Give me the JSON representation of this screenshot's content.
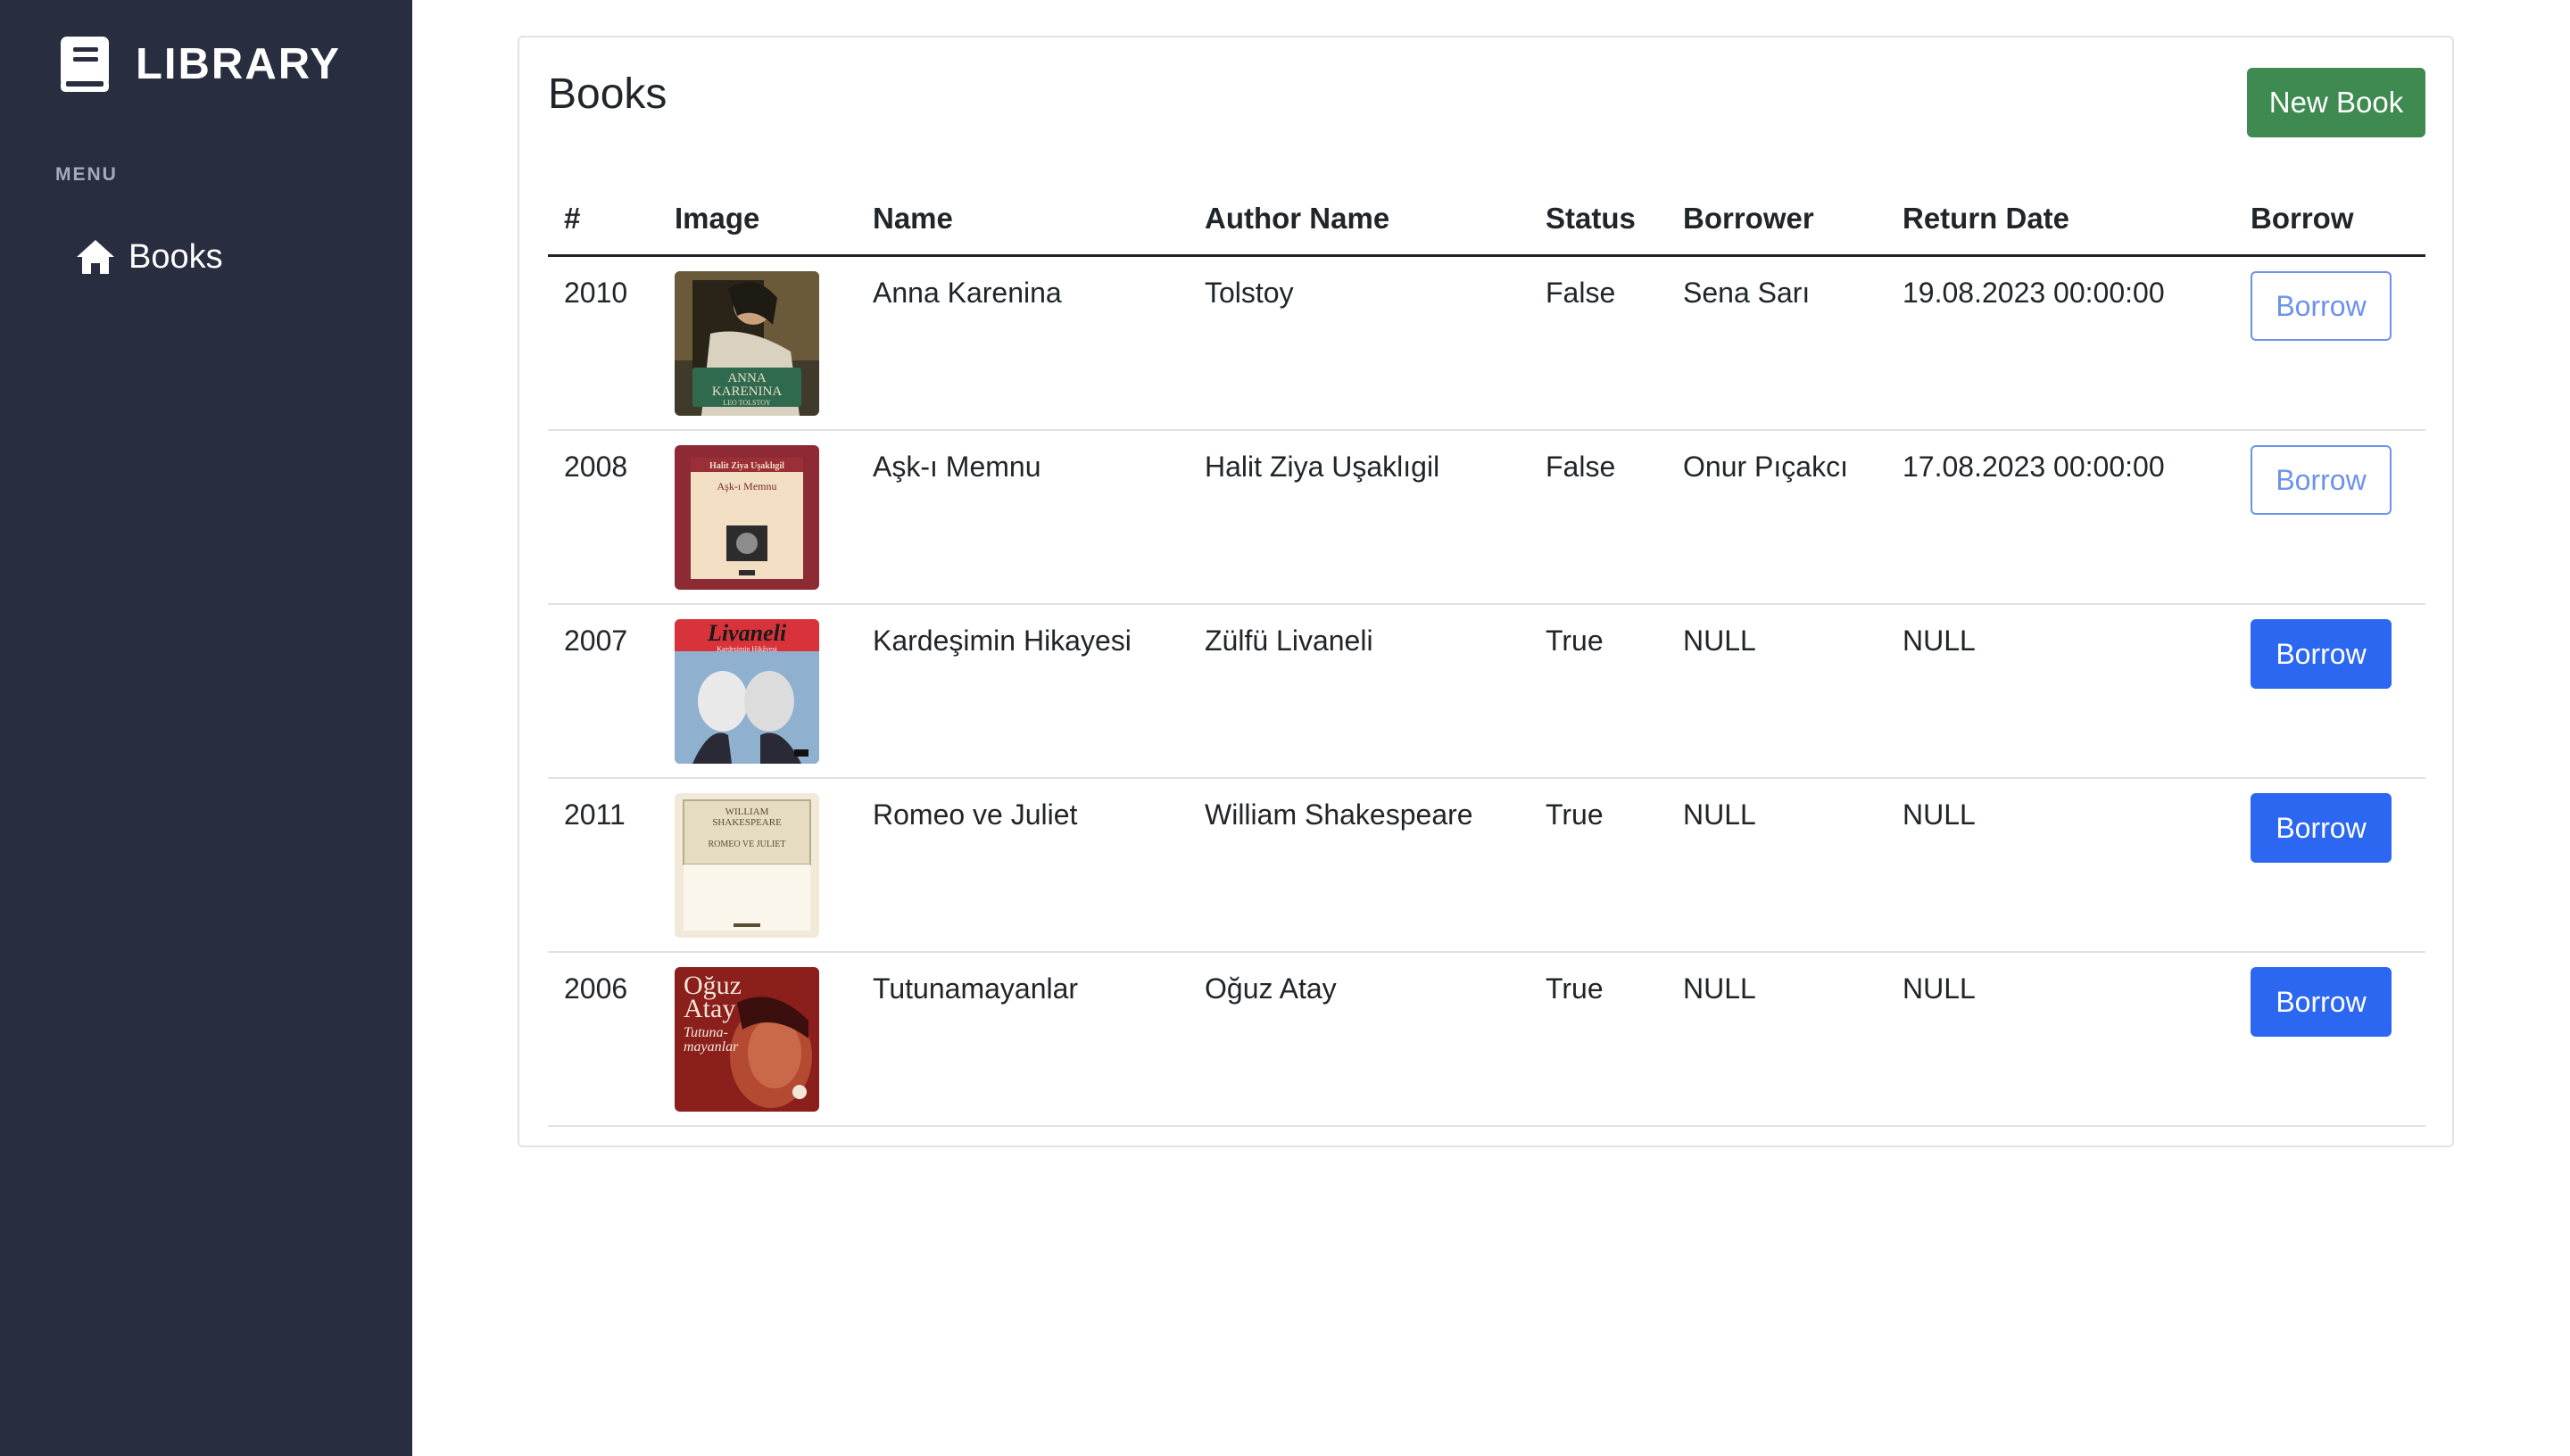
{
  "sidebar": {
    "brand": "LIBRARY",
    "menu_heading": "MENU",
    "items": [
      {
        "label": "Books",
        "icon": "home-icon"
      }
    ],
    "background": "#282d40"
  },
  "main": {
    "title": "Books",
    "new_book_label": "New Book",
    "table": {
      "headers": [
        "#",
        "Image",
        "Name",
        "Author Name",
        "Status",
        "Borrower",
        "Return Date",
        "Borrow"
      ],
      "rows": [
        {
          "id": "2010",
          "cover": "anna-karenina-cover",
          "name": "Anna Karenina",
          "author": "Tolstoy",
          "status": "False",
          "borrower": "Sena Sarı",
          "return_date": "19.08.2023 00:00:00",
          "borrow_label": "Borrow",
          "available": false
        },
        {
          "id": "2008",
          "cover": "ask-i-memnu-cover",
          "name": "Aşk-ı Memnu",
          "author": "Halit Ziya Uşaklıgil",
          "status": "False",
          "borrower": "Onur Pıçakcı",
          "return_date": "17.08.2023 00:00:00",
          "borrow_label": "Borrow",
          "available": false
        },
        {
          "id": "2007",
          "cover": "kardesimin-hikayesi-cover",
          "name": "Kardeşimin Hikayesi",
          "author": "Zülfü Livaneli",
          "status": "True",
          "borrower": "NULL",
          "return_date": "NULL",
          "borrow_label": "Borrow",
          "available": true
        },
        {
          "id": "2011",
          "cover": "romeo-ve-juliet-cover",
          "name": "Romeo ve Juliet",
          "author": "William Shakespeare",
          "status": "True",
          "borrower": "NULL",
          "return_date": "NULL",
          "borrow_label": "Borrow",
          "available": true
        },
        {
          "id": "2006",
          "cover": "tutunamayanlar-cover",
          "name": "Tutunamayanlar",
          "author": "Oğuz Atay",
          "status": "True",
          "borrower": "NULL",
          "return_date": "NULL",
          "borrow_label": "Borrow",
          "available": true
        }
      ]
    },
    "cover_text": {
      "anna": [
        "ANNA",
        "KARENINA",
        "LEO TOLSTOY"
      ],
      "ask": [
        "Halit Ziya Uşaklıgil",
        "Aşk-ı Memnu"
      ],
      "livaneli": [
        "Livaneli",
        "Kardeşimin Hikâyesi"
      ],
      "romeo": [
        "WILLIAM",
        "SHAKESPEARE",
        "ROMEO VE JULIET"
      ],
      "oguz": [
        "Oğuz",
        "Atay",
        "Tutuna-",
        "mayanlar"
      ]
    }
  },
  "colors": {
    "primary": "#2c67f2",
    "success": "#3f8a50",
    "sidebar_bg": "#282d40"
  }
}
